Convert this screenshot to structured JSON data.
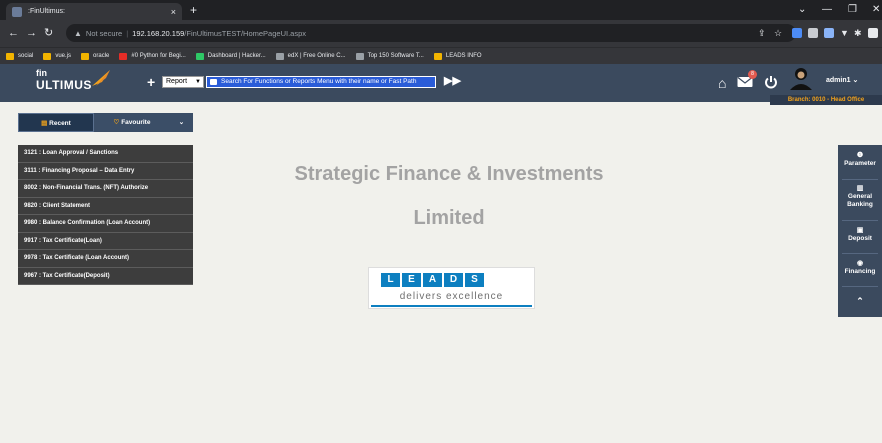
{
  "browser": {
    "tab_title": ":FinUltimus:",
    "tab_close": "×",
    "new_tab": "+",
    "url_security": "Not secure",
    "url_host": "192.168.20.159",
    "url_path": "/FinUltimusTEST/HomePageUI.aspx",
    "bookmarks": [
      {
        "label": "social",
        "color": "#f2b400"
      },
      {
        "label": "vue.js",
        "color": "#f2b400"
      },
      {
        "label": "oracle",
        "color": "#f2b400"
      },
      {
        "label": "#0 Python for Begi...",
        "color": "#e52d27"
      },
      {
        "label": "Dashboard | Hacker...",
        "color": "#2ec866"
      },
      {
        "label": "edX | Free Online C...",
        "color": "#9aa0a6"
      },
      {
        "label": "Top 150 Software T...",
        "color": "#9aa0a6"
      },
      {
        "label": "LEADS INFO",
        "color": "#f2b400"
      }
    ]
  },
  "header": {
    "logo_fin": "fin",
    "logo_ultimus": "ULTIMUS",
    "plus": "+",
    "select_value": "Report",
    "search_placeholder": "Search For Functions or Reports Menu with their name or Fast Path",
    "forward": "▶▶",
    "notification_count": "8",
    "user": "admin1 ⌄",
    "branch": "Branch: 0010 - Head Office"
  },
  "left_tabs": {
    "recent": "Recent",
    "favourite": "Favourite",
    "more": "⌄"
  },
  "recent_items": [
    "3121 : Loan Approval / Sanctions",
    "3111 : Financing Proposal – Data Entry",
    "8002 : Non-Financial Trans. (NFT) Authorize",
    "9820 : Client Statement",
    "9980 : Balance Confirmation (Loan Account)",
    "9917 : Tax Certificate(Loan)",
    "9978 : Tax Certificate (Loan Account)",
    "9967 : Tax Certificate(Deposit)"
  ],
  "main": {
    "company_line1": "Strategic Finance & Investments",
    "company_line2": "Limited",
    "leads_letters": [
      "L",
      "E",
      "A",
      "D",
      "S"
    ],
    "leads_tagline": "delivers excellence"
  },
  "right_panel": {
    "parameter": "Parameter",
    "general": "General",
    "banking": "Banking",
    "deposit": "Deposit",
    "financing": "Financing",
    "collapse": "⌃"
  },
  "colors": {
    "header_bg": "#3b4a5e",
    "branch_text": "#f4a31b",
    "leads_blue": "#0d7fc0",
    "recent_bg": "#3d3d3d"
  }
}
